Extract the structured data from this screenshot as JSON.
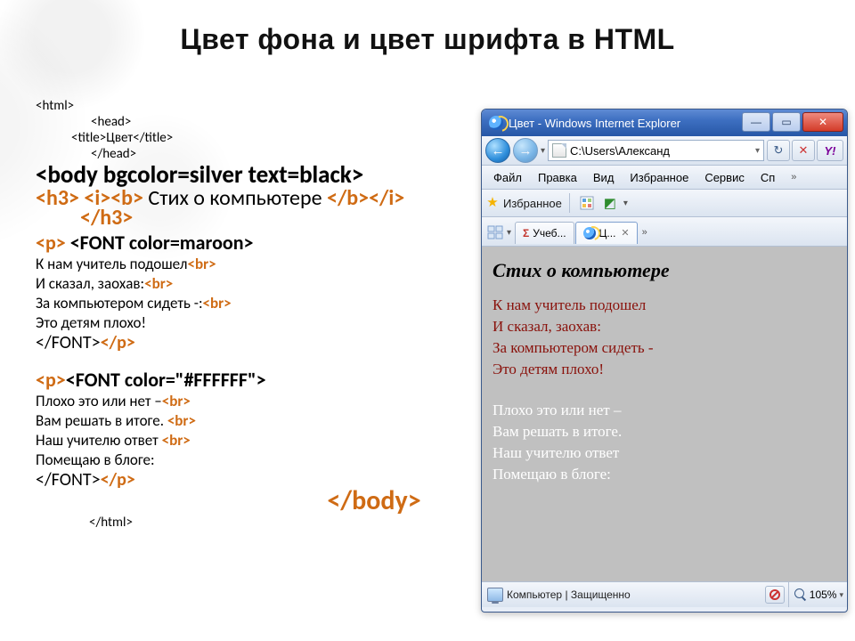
{
  "slide": {
    "title": "Цвет фона и цвет шрифта в HTML"
  },
  "source": {
    "html_open": "<html>",
    "head_open": "<head>",
    "title_open": "<title>",
    "title_text": "Цвет",
    "title_close": "</title>",
    "head_close": "</head>",
    "body_open": "<body bgcolor=silver text=black>",
    "h3_open": "<h3>",
    "ib_open": "<i><b>",
    "h3_text": " Стих о компьютере ",
    "ib_close": "</b></i>",
    "h3_close": "</h3>",
    "p_open": "<p>",
    "font_maroon": " <FONT color=maroon>",
    "poem1_l1": " К нам учитель подошел",
    "poem1_l2": "И сказал, заохав:",
    "poem1_l3": "За компьютером сидеть -:",
    "poem1_l4": "Это детям плохо!",
    "br": "<br>",
    "font_close": "</FONT>",
    "p_close": "</p>",
    "font_white": "<FONT color=\"#FFFFFF\">",
    "poem2_l1": "Плохо это или нет –",
    "poem2_l2": "Вам решать в итоге. ",
    "poem2_l3": "Наш учителю ответ ",
    "poem2_l4": "Помещаю в блоге:",
    "body_close": "</body>",
    "html_close": "</html>"
  },
  "browser": {
    "window_title": "Цвет - Windows Internet Explorer",
    "address": "C:\\Users\\Александ",
    "menu": {
      "file": "Файл",
      "edit": "Правка",
      "view": "Вид",
      "favorites": "Избранное",
      "service": "Сервис",
      "help": "Сп"
    },
    "favorites_label": "Избранное",
    "tabs": {
      "tab1_label": "Учеб...",
      "tab2_label": "Ц..."
    },
    "rendered": {
      "heading": "Стих о компьютере",
      "p1_l1": "К нам учитель подошел",
      "p1_l2": "И сказал, заохав:",
      "p1_l3": "За компьютером сидеть -",
      "p1_l4": "Это детям плохо!",
      "p2_l1": "Плохо это или нет –",
      "p2_l2": "Вам решать в итоге.",
      "p2_l3": "Наш учителю ответ",
      "p2_l4": "Помещаю в блоге:"
    },
    "status": {
      "zone": "Компьютер | Защищенно",
      "zoom": "105%"
    }
  }
}
